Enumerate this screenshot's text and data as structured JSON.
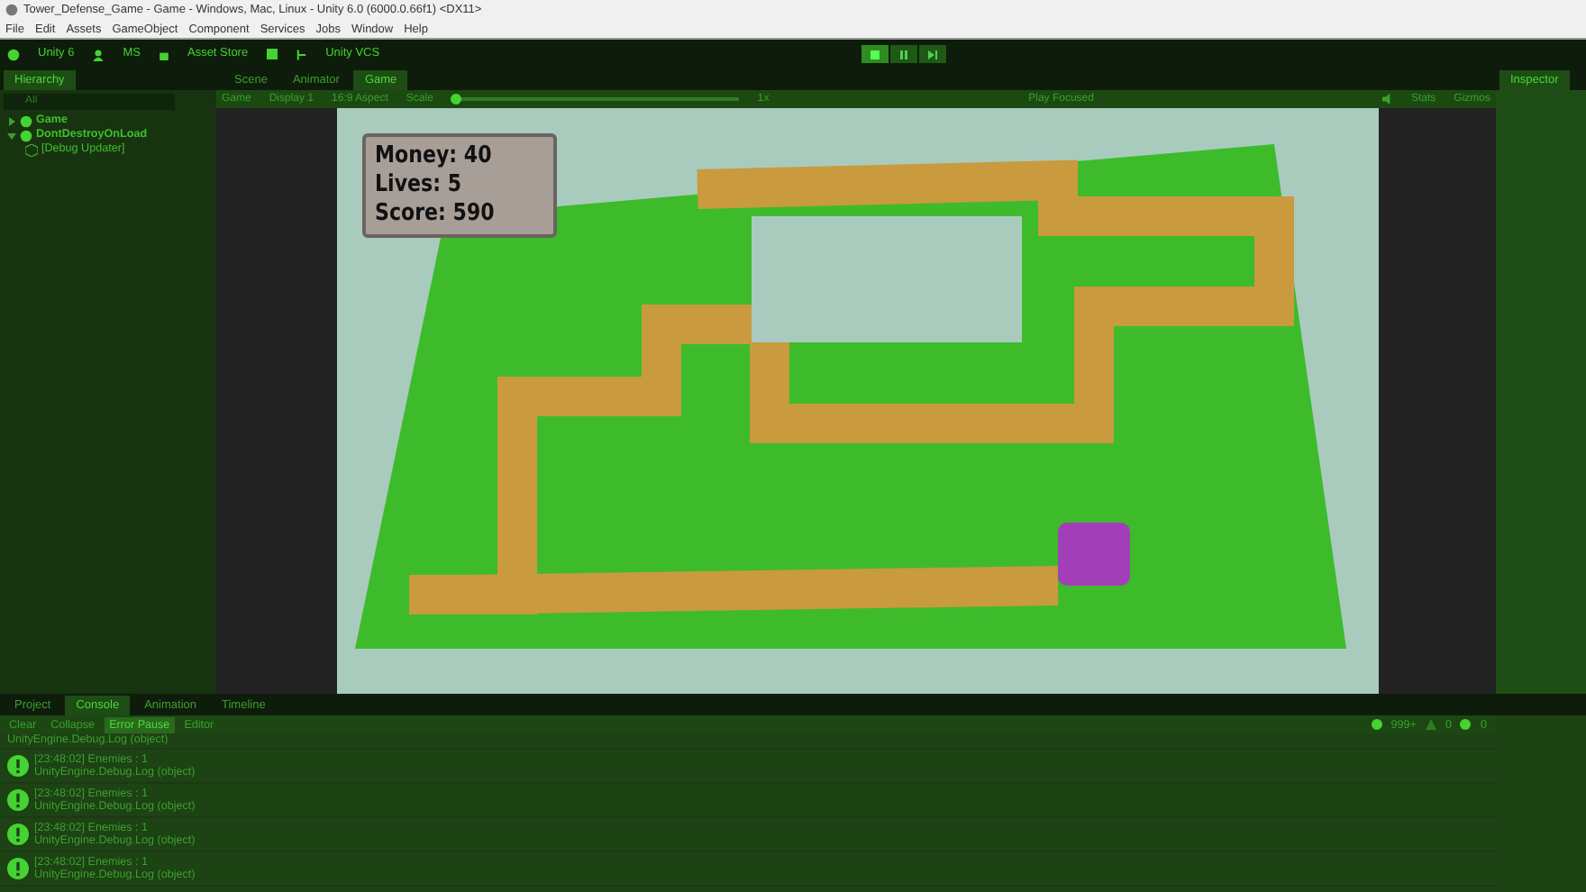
{
  "window": {
    "title": "Tower_Defense_Game - Game - Windows, Mac, Linux - Unity 6.0 (6000.0.66f1) <DX11>"
  },
  "menu": [
    "File",
    "Edit",
    "Assets",
    "GameObject",
    "Component",
    "Services",
    "Jobs",
    "Window",
    "Help"
  ],
  "toolbar": {
    "account": "Unity 6",
    "user": "MS",
    "asset_store": "Asset Store",
    "vcs": "Unity VCS",
    "play": {
      "playing": true,
      "paused": false
    }
  },
  "hierarchy": {
    "tab": "Hierarchy",
    "search": {
      "placeholder": "All"
    },
    "items": [
      {
        "label": "Game",
        "expanded": false
      },
      {
        "label": "DontDestroyOnLoad",
        "expanded": true,
        "children": [
          {
            "label": "[Debug Updater]"
          }
        ]
      }
    ]
  },
  "center_tabs": [
    {
      "label": "Scene",
      "selected": false
    },
    {
      "label": "Animator",
      "selected": false
    },
    {
      "label": "Game",
      "selected": true
    }
  ],
  "game_toolbar": {
    "mode": "Game",
    "display": "Display 1",
    "aspect": "16:9 Aspect",
    "scale_label": "Scale",
    "scale_value": "1x",
    "scale_slider": {
      "level": 0
    },
    "play_focus": "Play Focused",
    "stats": "Stats",
    "gizmos": "Gizmos"
  },
  "hud": [
    "Money: 40",
    "Lives: 5",
    "Score: 590"
  ],
  "inspector": {
    "tab": "Inspector"
  },
  "bottom_tabs": [
    {
      "label": "Project",
      "selected": false
    },
    {
      "label": "Console",
      "selected": true
    },
    {
      "label": "Animation",
      "selected": false
    },
    {
      "label": "Timeline",
      "selected": false
    }
  ],
  "console": {
    "buttons": [
      {
        "label": "Clear",
        "on": false
      },
      {
        "label": "Collapse",
        "on": false
      },
      {
        "label": "Error Pause",
        "on": true
      },
      {
        "label": "Editor",
        "on": false
      }
    ],
    "counts": {
      "logs": "999+",
      "warnings": "0",
      "errors": "0"
    },
    "entries": [
      {
        "line_2": "UnityEngine.Debug.Log (object)"
      },
      {
        "line_1": "[23:48:02] Enemies : 1",
        "line_2": "UnityEngine.Debug.Log (object)"
      },
      {
        "line_1": "[23:48:02] Enemies : 1",
        "line_2": "UnityEngine.Debug.Log (object)"
      },
      {
        "line_1": "[23:48:02] Enemies : 1",
        "line_2": "UnityEngine.Debug.Log (object)"
      },
      {
        "line_1": "[23:48:02] Enemies : 1",
        "line_2": "UnityEngine.Debug.Log (object)"
      }
    ]
  }
}
